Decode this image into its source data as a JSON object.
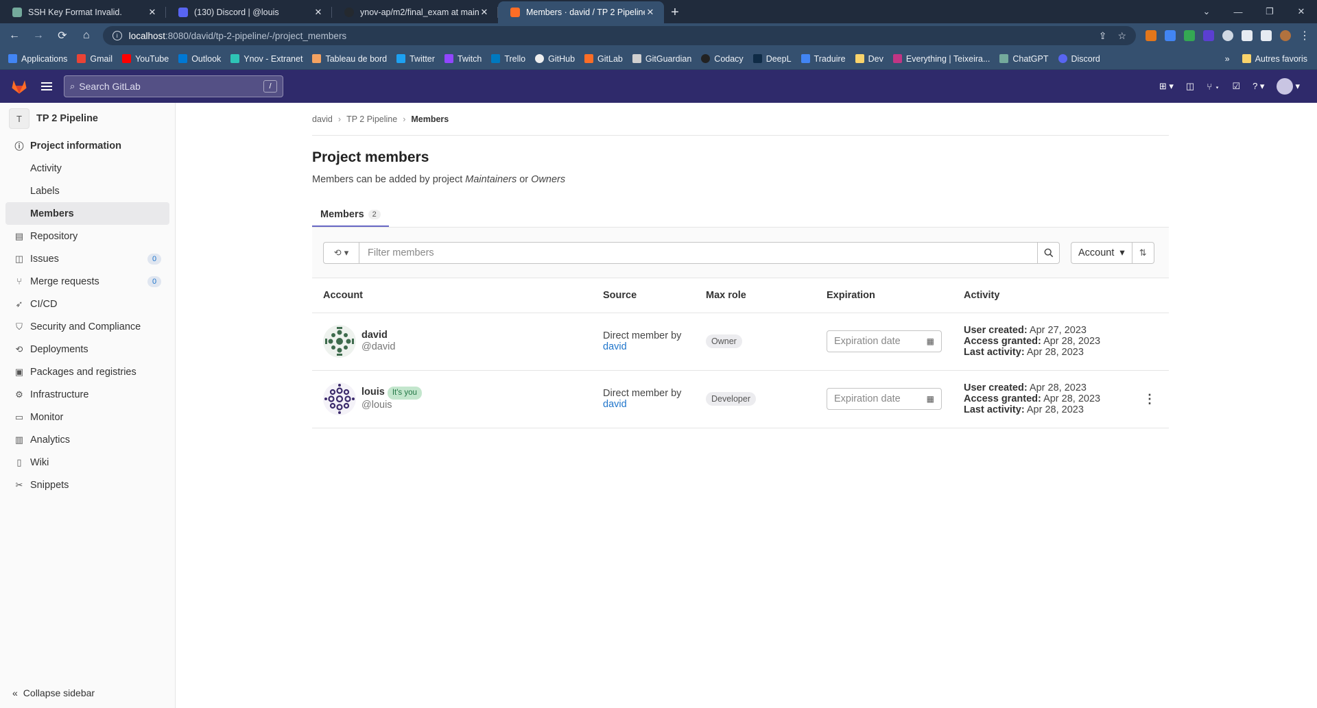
{
  "browser": {
    "tabs": [
      {
        "title": "SSH Key Format Invalid.",
        "favicon_color": "#74aa9c"
      },
      {
        "title": "(130) Discord | @louis",
        "favicon_color": "#5865f2"
      },
      {
        "title": "ynov-ap/m2/final_exam at main",
        "favicon_color": "#24292f"
      },
      {
        "title": "Members · david / TP 2 Pipeline",
        "favicon_color": "#fc6d26"
      }
    ],
    "url_host": "localhost",
    "url_path": ":8080/david/tp-2-pipeline/-/project_members",
    "bookmarks": [
      {
        "label": "Applications",
        "color": "#4285f4"
      },
      {
        "label": "Gmail",
        "color": "#ea4335"
      },
      {
        "label": "YouTube",
        "color": "#ff0000"
      },
      {
        "label": "Outlook",
        "color": "#0078d4"
      },
      {
        "label": "Ynov - Extranet",
        "color": "#2ec4b6"
      },
      {
        "label": "Tableau de bord",
        "color": "#f4a261"
      },
      {
        "label": "Twitter",
        "color": "#1da1f2"
      },
      {
        "label": "Twitch",
        "color": "#9146ff"
      },
      {
        "label": "Trello",
        "color": "#0079bf"
      },
      {
        "label": "GitHub",
        "color": "#eeeeee"
      },
      {
        "label": "GitLab",
        "color": "#fc6d26"
      },
      {
        "label": "GitGuardian",
        "color": "#d0d0d0"
      },
      {
        "label": "Codacy",
        "color": "#222222"
      },
      {
        "label": "DeepL",
        "color": "#0f2b46"
      },
      {
        "label": "Traduire",
        "color": "#4285f4"
      },
      {
        "label": "Dev",
        "color": "#f9d36b"
      },
      {
        "label": "Everything | Teixeira...",
        "color": "#c13584"
      },
      {
        "label": "ChatGPT",
        "color": "#74aa9c"
      },
      {
        "label": "Discord",
        "color": "#5865f2"
      }
    ],
    "bookmarks_more": "»",
    "other_bookmarks": "Autres favoris"
  },
  "gitlab": {
    "search_placeholder": "Search GitLab",
    "search_shortcut": "/"
  },
  "sidebar": {
    "project_initial": "T",
    "project_name": "TP 2 Pipeline",
    "items": [
      {
        "label": "Project information",
        "icon": "info-icon"
      },
      {
        "label": "Activity"
      },
      {
        "label": "Labels"
      },
      {
        "label": "Members"
      },
      {
        "label": "Repository",
        "icon": "document-icon"
      },
      {
        "label": "Issues",
        "icon": "issues-icon",
        "count": "0"
      },
      {
        "label": "Merge requests",
        "icon": "merge-request-icon",
        "count": "0"
      },
      {
        "label": "CI/CD",
        "icon": "rocket-icon"
      },
      {
        "label": "Security and Compliance",
        "icon": "shield-icon"
      },
      {
        "label": "Deployments",
        "icon": "deployments-icon"
      },
      {
        "label": "Packages and registries",
        "icon": "package-icon"
      },
      {
        "label": "Infrastructure",
        "icon": "cloud-gear-icon"
      },
      {
        "label": "Monitor",
        "icon": "monitor-icon"
      },
      {
        "label": "Analytics",
        "icon": "chart-icon"
      },
      {
        "label": "Wiki",
        "icon": "book-icon"
      },
      {
        "label": "Snippets",
        "icon": "scissors-icon"
      }
    ],
    "collapse_label": "Collapse sidebar"
  },
  "main": {
    "breadcrumb": [
      "david",
      "TP 2 Pipeline",
      "Members"
    ],
    "title": "Project members",
    "description_prefix": "Members can be added by project ",
    "description_role1": "Maintainers",
    "description_middle": " or ",
    "description_role2": "Owners",
    "tab_label": "Members",
    "tab_count": "2",
    "filter_placeholder": "Filter members",
    "sort_label": "Account",
    "columns": [
      "Account",
      "Source",
      "Max role",
      "Expiration",
      "Activity"
    ],
    "members": [
      {
        "name": "david",
        "handle": "@david",
        "is_you": false,
        "source_prefix": "Direct member by",
        "source_user": "david",
        "role": "Owner",
        "expiration_placeholder": "Expiration date",
        "user_created_label": "User created:",
        "user_created": "Apr 27, 2023",
        "access_granted_label": "Access granted:",
        "access_granted": "Apr 28, 2023",
        "last_activity_label": "Last activity:",
        "last_activity": "Apr 28, 2023",
        "avatar_color": "#3e6b4d"
      },
      {
        "name": "louis",
        "handle": "@louis",
        "is_you": true,
        "you_label": "It's you",
        "source_prefix": "Direct member by",
        "source_user": "david",
        "role": "Developer",
        "expiration_placeholder": "Expiration date",
        "user_created_label": "User created:",
        "user_created": "Apr 28, 2023",
        "access_granted_label": "Access granted:",
        "access_granted": "Apr 28, 2023",
        "last_activity_label": "Last activity:",
        "last_activity": "Apr 28, 2023",
        "avatar_color": "#3b2a6b"
      }
    ]
  }
}
